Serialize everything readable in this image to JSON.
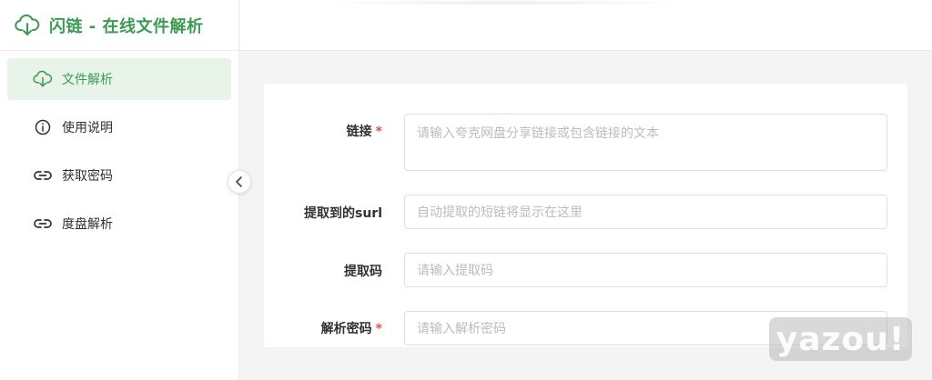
{
  "brand": {
    "title": "闪链 - 在线文件解析",
    "icon": "cloud-download-icon",
    "color": "#3c9a53"
  },
  "sidebar": {
    "items": [
      {
        "label": "文件解析",
        "icon": "cloud-download-icon",
        "active": true
      },
      {
        "label": "使用说明",
        "icon": "info-circle-icon",
        "active": false
      },
      {
        "label": "获取密码",
        "icon": "link-icon",
        "active": false
      },
      {
        "label": "度盘解析",
        "icon": "link-icon",
        "active": false
      }
    ],
    "collapse_icon": "chevron-left-icon"
  },
  "form": {
    "link": {
      "label": "链接",
      "required": "*",
      "placeholder": "请输入夸克网盘分享链接或包含链接的文本"
    },
    "surl": {
      "label": "提取到的surl",
      "placeholder": "自动提取的短链将显示在这里"
    },
    "code": {
      "label": "提取码",
      "placeholder": "请输入提取码"
    },
    "password": {
      "label": "解析密码",
      "required": "*",
      "placeholder": "请输入解析密码"
    }
  },
  "watermark": "yazou!"
}
